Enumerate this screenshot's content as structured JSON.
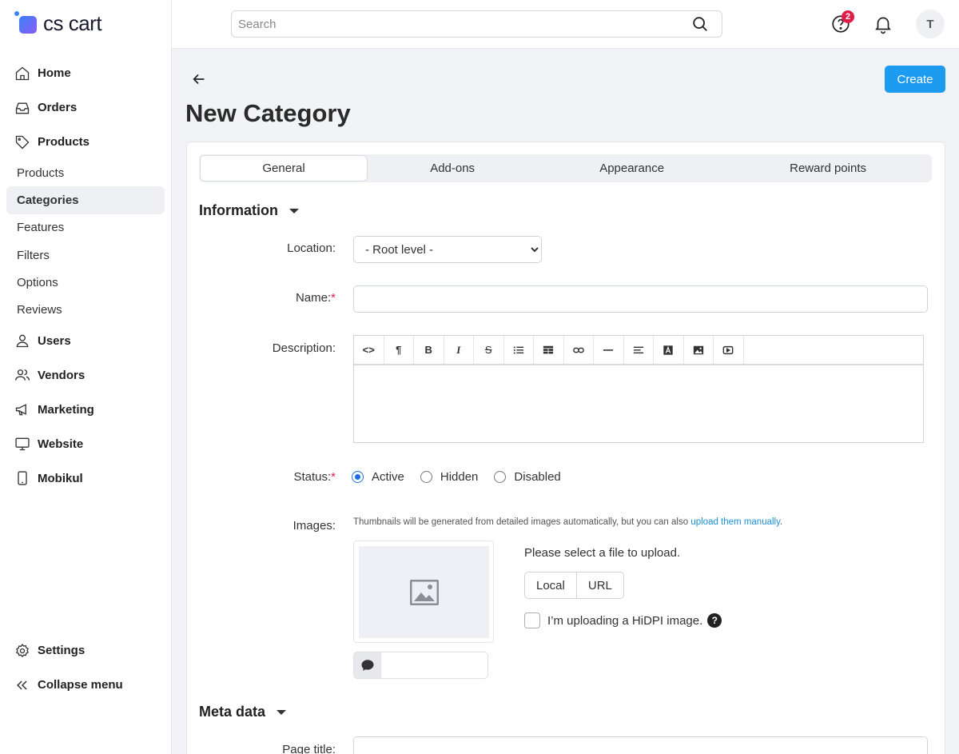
{
  "app": {
    "logo_text": "cs cart"
  },
  "sidebar": {
    "items": [
      {
        "label": "Home",
        "icon": "home-icon"
      },
      {
        "label": "Orders",
        "icon": "inbox-icon"
      },
      {
        "label": "Products",
        "icon": "tag-icon"
      }
    ],
    "sub_items": [
      {
        "label": "Products"
      },
      {
        "label": "Categories",
        "active": true
      },
      {
        "label": "Features"
      },
      {
        "label": "Filters"
      },
      {
        "label": "Options"
      },
      {
        "label": "Reviews"
      }
    ],
    "items2": [
      {
        "label": "Users",
        "icon": "user-icon"
      },
      {
        "label": "Vendors",
        "icon": "users-icon"
      },
      {
        "label": "Marketing",
        "icon": "megaphone-icon"
      },
      {
        "label": "Website",
        "icon": "monitor-icon"
      },
      {
        "label": "Mobikul",
        "icon": "smartphone-icon"
      }
    ],
    "bottom": [
      {
        "label": "Settings",
        "icon": "gear-icon"
      },
      {
        "label": "Collapse menu",
        "icon": "double-chevron-left-icon"
      }
    ]
  },
  "header": {
    "search_placeholder": "Search",
    "help_badge": "2",
    "avatar_initial": "T"
  },
  "main": {
    "title": "New Category",
    "create_label": "Create",
    "tabs": [
      {
        "label": "General",
        "active": true
      },
      {
        "label": "Add-ons"
      },
      {
        "label": "Appearance"
      },
      {
        "label": "Reward points"
      }
    ],
    "information": {
      "title": "Information",
      "location_label": "Location:",
      "location_value": "- Root level -",
      "name_label": "Name:",
      "description_label": "Description:",
      "status_label": "Status:",
      "status_options": [
        "Active",
        "Hidden",
        "Disabled"
      ],
      "status_selected": "Active",
      "images_label": "Images:",
      "images_hint": "Thumbnails will be generated from detailed images automatically, but you can also ",
      "images_hint_link": "upload them manually",
      "images_hint_end": ".",
      "upload_prompt": "Please select a file to upload.",
      "upload_local": "Local",
      "upload_url": "URL",
      "hidpi_label": "I’m uploading a HiDPI image.",
      "help_mark": "?"
    },
    "meta": {
      "title": "Meta data",
      "page_title_label": "Page title:"
    }
  },
  "colors": {
    "accent": "#1d9bf0",
    "badge": "#e11d48",
    "link": "#1d8fd6"
  }
}
